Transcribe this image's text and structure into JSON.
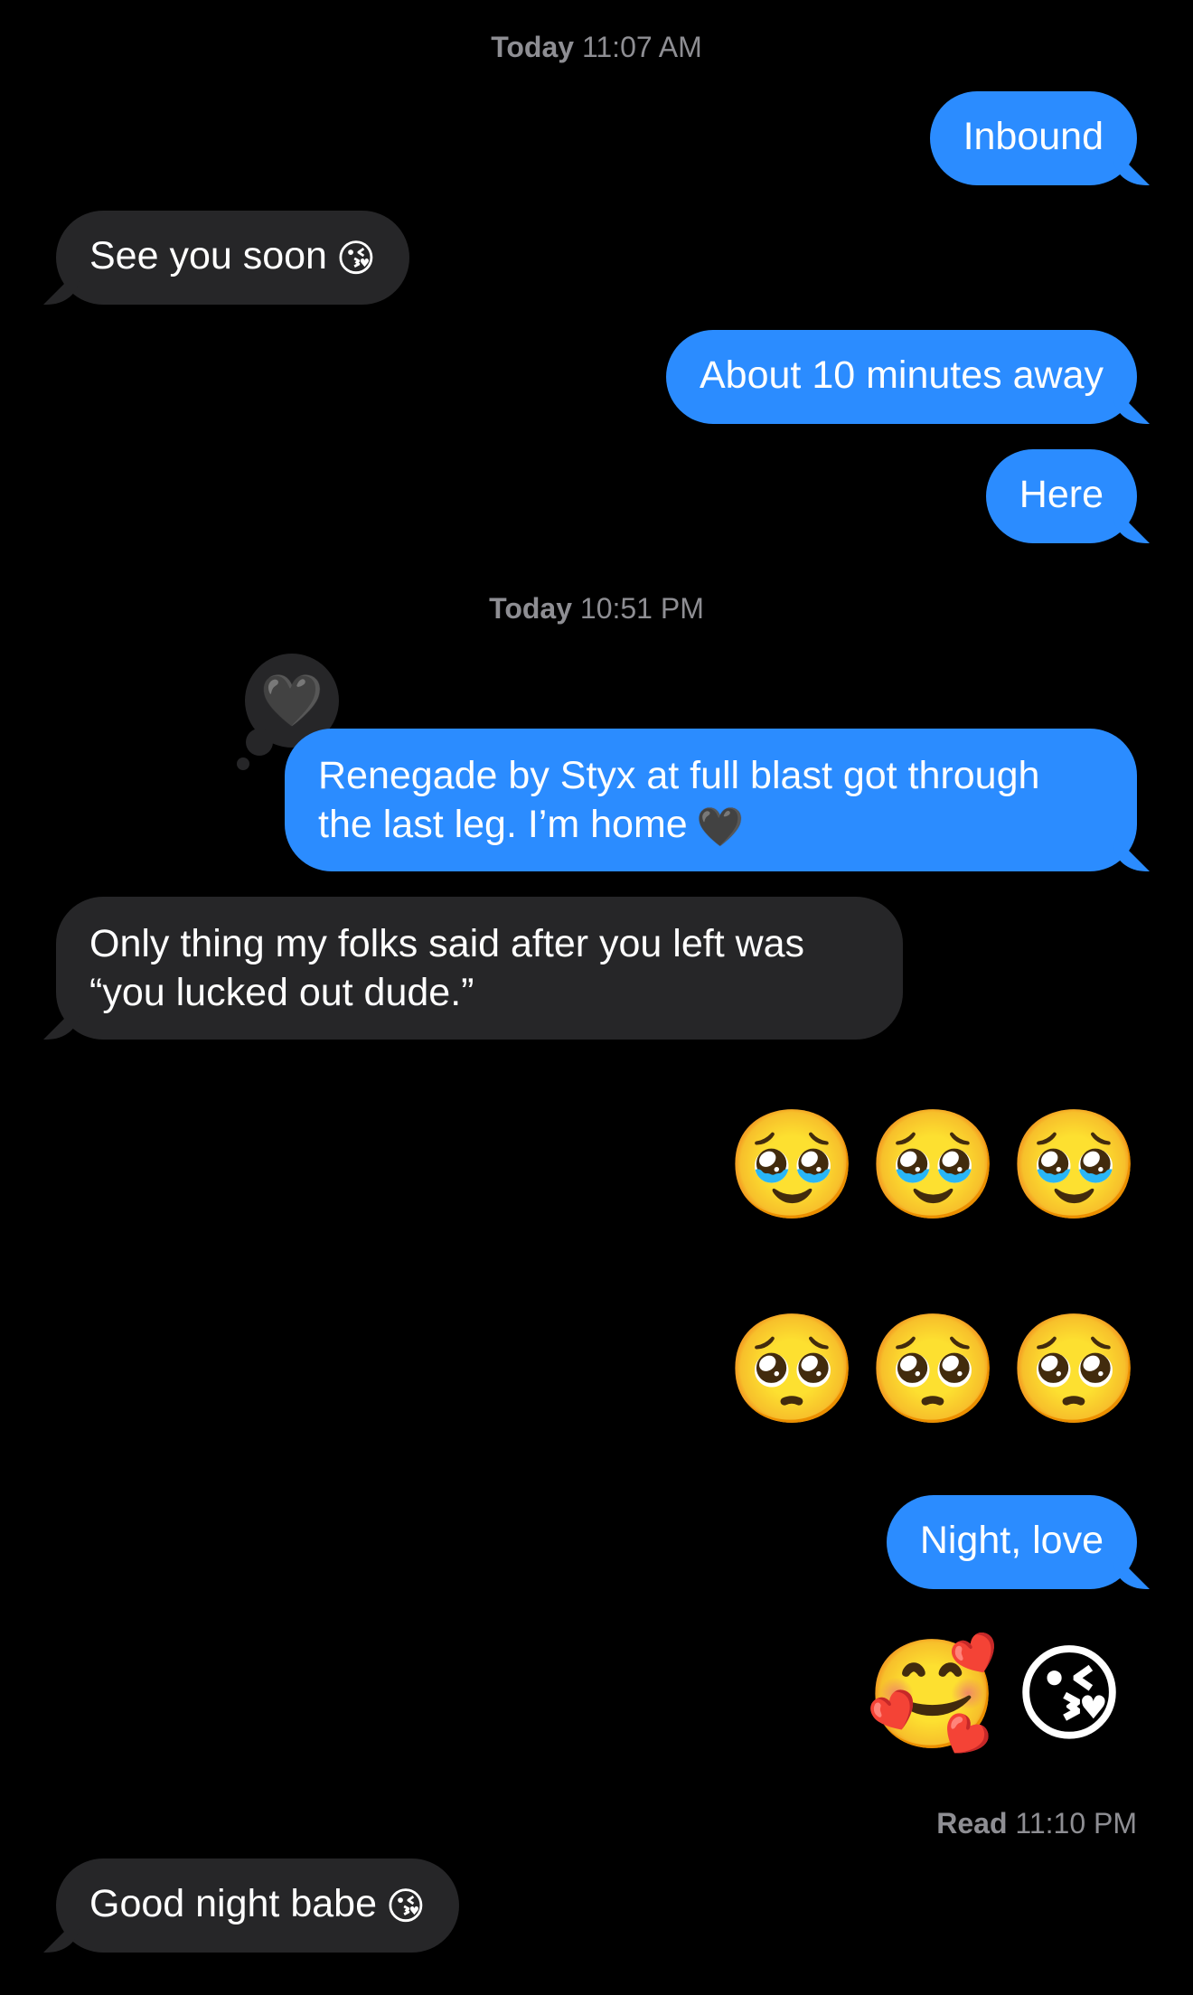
{
  "timestamps": [
    {
      "day": "Today",
      "time": "11:07 AM"
    },
    {
      "day": "Today",
      "time": "10:51 PM"
    }
  ],
  "messages": [
    {
      "dir": "out",
      "text": "Inbound"
    },
    {
      "dir": "in",
      "text": "See you soon",
      "emoji": "😘"
    },
    {
      "dir": "out",
      "text": "About 10 minutes away"
    },
    {
      "dir": "out",
      "text": "Here"
    },
    {
      "dir": "out",
      "line1": "Renegade by Styx at full blast got through",
      "line2": "the last leg. I’m home",
      "emoji": "🖤",
      "tapback": "🖤"
    },
    {
      "dir": "in",
      "line1": "Only thing my folks said after you left was",
      "line2": "“you lucked out dude.”"
    },
    {
      "dir": "out",
      "emoji_row1": [
        "🥹",
        "🥹",
        "🥹"
      ],
      "emoji_row2": [
        "🥺",
        "🥺",
        "🥺"
      ]
    },
    {
      "dir": "out",
      "text": "Night, love"
    },
    {
      "dir": "out",
      "emoji_row": [
        "🥰",
        "😘"
      ]
    },
    {
      "dir": "in",
      "text": "Good night babe",
      "emoji": "😘"
    }
  ],
  "receipt": {
    "label": "Read",
    "time": "11:10 PM"
  }
}
